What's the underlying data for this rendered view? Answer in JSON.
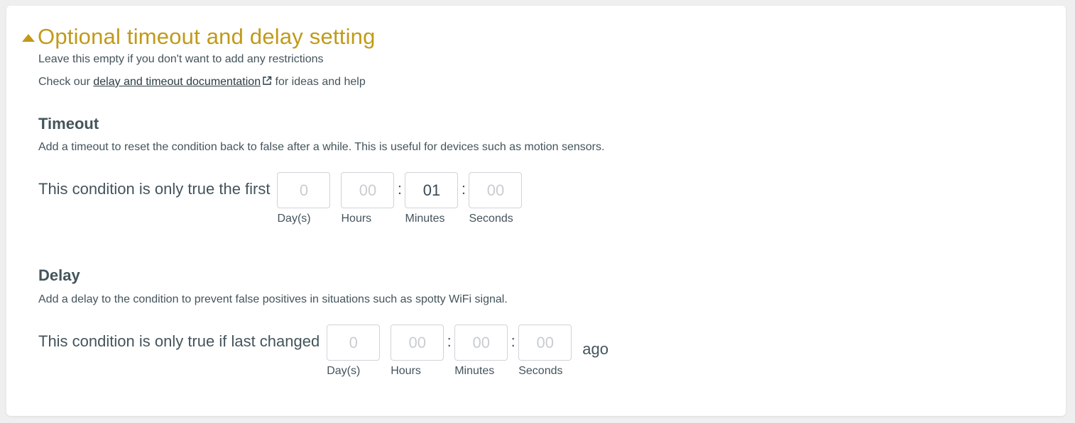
{
  "section": {
    "title": "Optional timeout and delay setting",
    "intro": "Leave this empty if you don't want to add any restrictions",
    "doc_prefix": "Check our ",
    "doc_link": "delay and timeout documentation",
    "doc_suffix": " for ideas and help"
  },
  "timeout": {
    "title": "Timeout",
    "description": "Add a timeout to reset the condition back to false after a while. This is useful for devices such as motion sensors.",
    "label": "This condition is only true the first",
    "fields": {
      "days": {
        "value": "",
        "placeholder": "0",
        "label": "Day(s)"
      },
      "hours": {
        "value": "",
        "placeholder": "00",
        "label": "Hours"
      },
      "minutes": {
        "value": "01",
        "placeholder": "00",
        "label": "Minutes"
      },
      "seconds": {
        "value": "",
        "placeholder": "00",
        "label": "Seconds"
      }
    },
    "separator": ":"
  },
  "delay": {
    "title": "Delay",
    "description": "Add a delay to the condition to prevent false positives in situations such as spotty WiFi signal.",
    "label": "This condition is only true if last changed",
    "fields": {
      "days": {
        "value": "",
        "placeholder": "0",
        "label": "Day(s)"
      },
      "hours": {
        "value": "",
        "placeholder": "00",
        "label": "Hours"
      },
      "minutes": {
        "value": "",
        "placeholder": "00",
        "label": "Minutes"
      },
      "seconds": {
        "value": "",
        "placeholder": "00",
        "label": "Seconds"
      }
    },
    "separator": ":",
    "suffix": "ago"
  },
  "colors": {
    "accent": "#c19a18",
    "text": "#44545c",
    "border": "#cfd4d7"
  }
}
